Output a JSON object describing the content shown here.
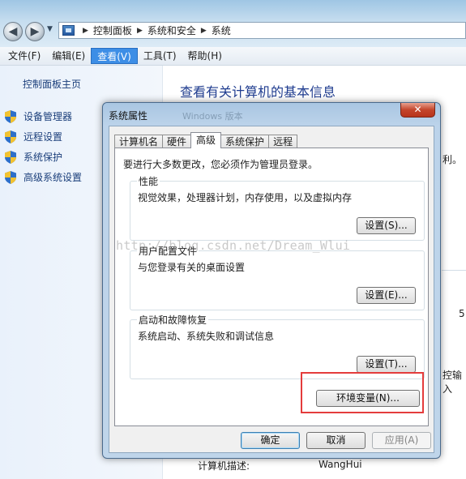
{
  "address_bar": {
    "crumbs": [
      "控制面板",
      "系统和安全",
      "系统"
    ]
  },
  "menu": {
    "items": [
      "文件(F)",
      "编辑(E)",
      "查看(V)",
      "工具(T)",
      "帮助(H)"
    ],
    "active_index": 2
  },
  "left_pane": {
    "home_link": "控制面板主页",
    "tasks": [
      "设备管理器",
      "远程设置",
      "系统保护",
      "高级系统设置"
    ]
  },
  "main": {
    "title": "查看有关计算机的基本信息",
    "fragment_right_1": "利。",
    "fragment_right_2": "5",
    "fragment_right_3": "控输入",
    "computer_desc_label": "计算机描述:",
    "computer_desc_value": "WangHui"
  },
  "dialog": {
    "title": "系统属性",
    "ghost_text": "Windows 版本",
    "close_glyph": "✕",
    "tabs": [
      "计算机名",
      "硬件",
      "高级",
      "系统保护",
      "远程"
    ],
    "active_tab_index": 2,
    "admin_note": "要进行大多数更改，您必须作为管理员登录。",
    "groups": {
      "performance": {
        "title": "性能",
        "desc": "视觉效果，处理器计划，内存使用，以及虚拟内存",
        "button": "设置(S)..."
      },
      "user_profiles": {
        "title": "用户配置文件",
        "desc": "与您登录有关的桌面设置",
        "button": "设置(E)..."
      },
      "startup_recovery": {
        "title": "启动和故障恢复",
        "desc": "系统启动、系统失败和调试信息",
        "button": "设置(T)..."
      }
    },
    "env_button": "环境变量(N)...",
    "ok_button": "确定",
    "cancel_button": "取消",
    "apply_button": "应用(A)"
  },
  "watermark": "http://blog.csdn.net/Dream_Wlui",
  "colors": {
    "highlight_box": "#e43c3c",
    "menu_active": "#3d8ee6",
    "link": "#1a3e7a",
    "title_blue": "#1f3c8f"
  }
}
